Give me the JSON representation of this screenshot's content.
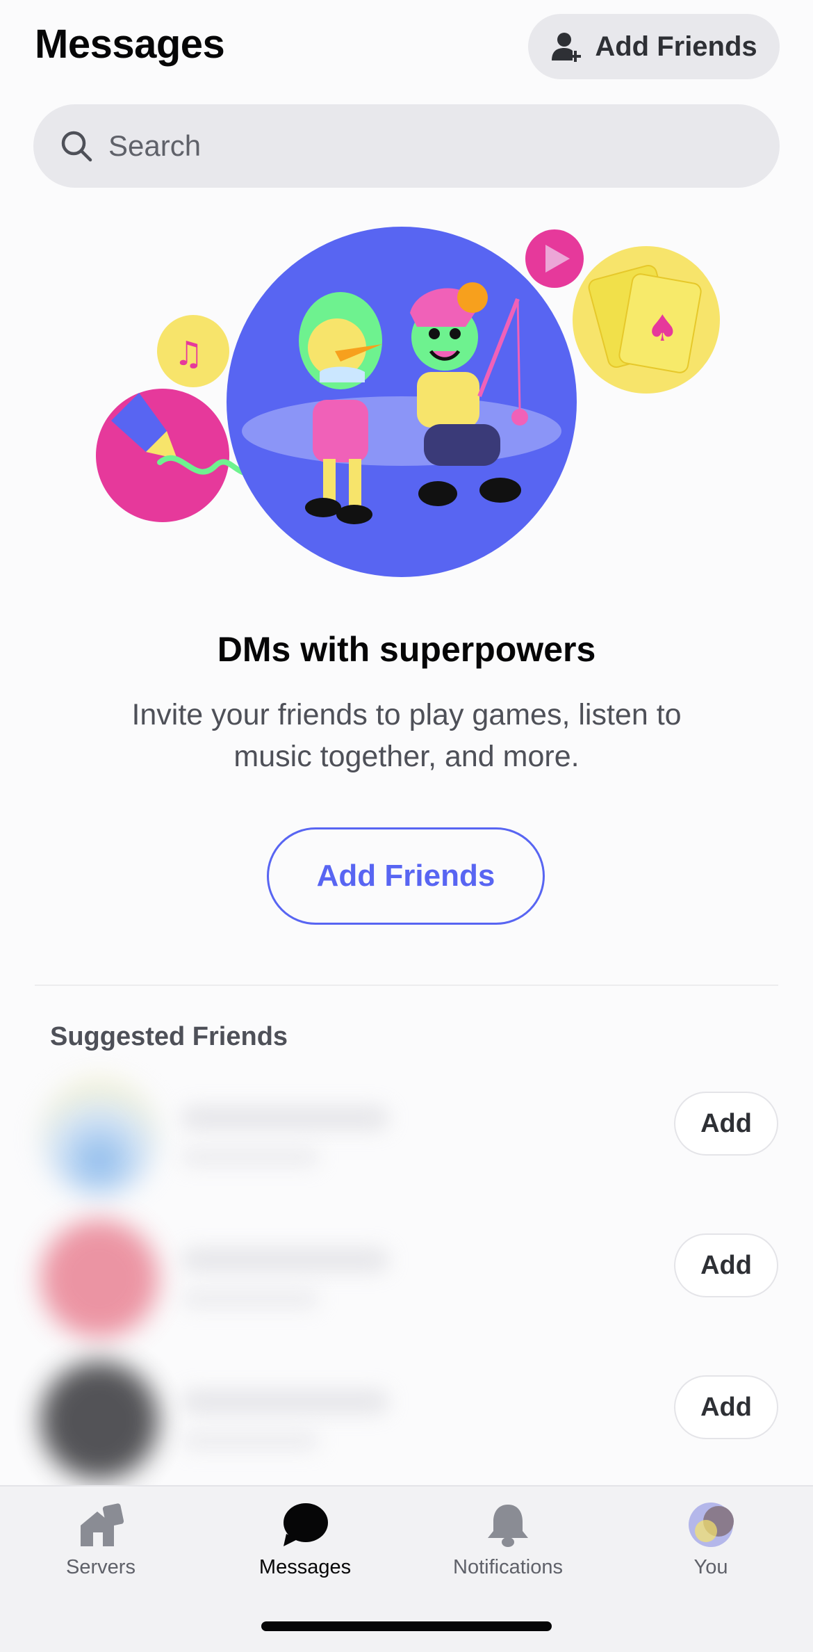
{
  "header": {
    "title": "Messages",
    "add_friends_label": "Add Friends"
  },
  "search": {
    "placeholder": "Search"
  },
  "empty_state": {
    "title": "DMs with superpowers",
    "subtitle": "Invite your friends to play games, listen to music together, and more.",
    "button_label": "Add Friends"
  },
  "suggested": {
    "section_label": "Suggested Friends",
    "items": [
      {
        "add_label": "Add"
      },
      {
        "add_label": "Add"
      },
      {
        "add_label": "Add"
      }
    ]
  },
  "tabs": [
    {
      "label": "Servers",
      "icon": "servers-icon",
      "active": false
    },
    {
      "label": "Messages",
      "icon": "messages-icon",
      "active": true
    },
    {
      "label": "Notifications",
      "icon": "bell-icon",
      "active": false
    },
    {
      "label": "You",
      "icon": "avatar",
      "active": false
    }
  ],
  "colors": {
    "accent": "#5865f2",
    "background": "#fbfbfc",
    "pill": "#e8e8ec"
  }
}
